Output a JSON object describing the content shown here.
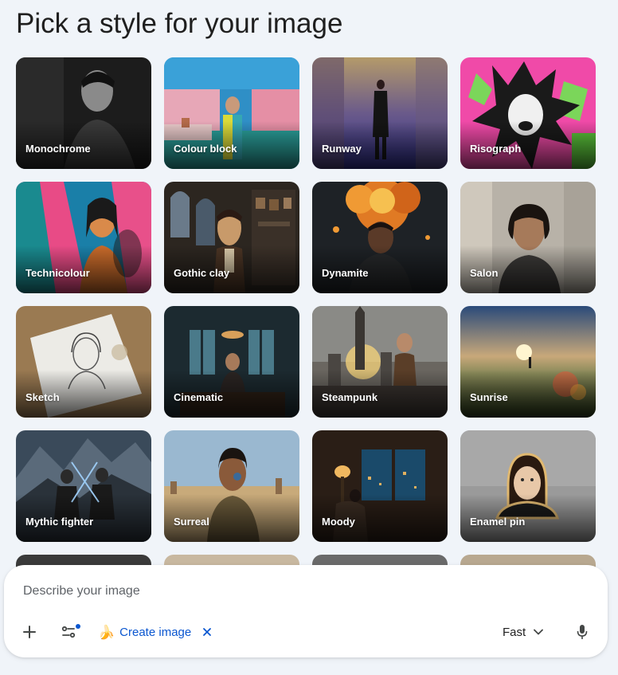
{
  "heading": "Pick a style for your image",
  "styles": [
    {
      "label": "Monochrome"
    },
    {
      "label": "Colour block"
    },
    {
      "label": "Runway"
    },
    {
      "label": "Risograph"
    },
    {
      "label": "Technicolour"
    },
    {
      "label": "Gothic clay"
    },
    {
      "label": "Dynamite"
    },
    {
      "label": "Salon"
    },
    {
      "label": "Sketch"
    },
    {
      "label": "Cinematic"
    },
    {
      "label": "Steampunk"
    },
    {
      "label": "Sunrise"
    },
    {
      "label": "Mythic fighter"
    },
    {
      "label": "Surreal"
    },
    {
      "label": "Moody"
    },
    {
      "label": "Enamel pin"
    }
  ],
  "composer": {
    "placeholder": "Describe your image",
    "tool_chip": "Create image",
    "mode": "Fast",
    "icons": {
      "add": "plus-icon",
      "tools": "tune-icon",
      "chip": "banana-icon",
      "close": "close-icon",
      "mode": "chevron-down-icon",
      "mic": "microphone-icon"
    }
  },
  "colors": {
    "page_bg": "#f0f4f9",
    "accent": "#0b57d0",
    "indicator": "#0b57d0"
  }
}
